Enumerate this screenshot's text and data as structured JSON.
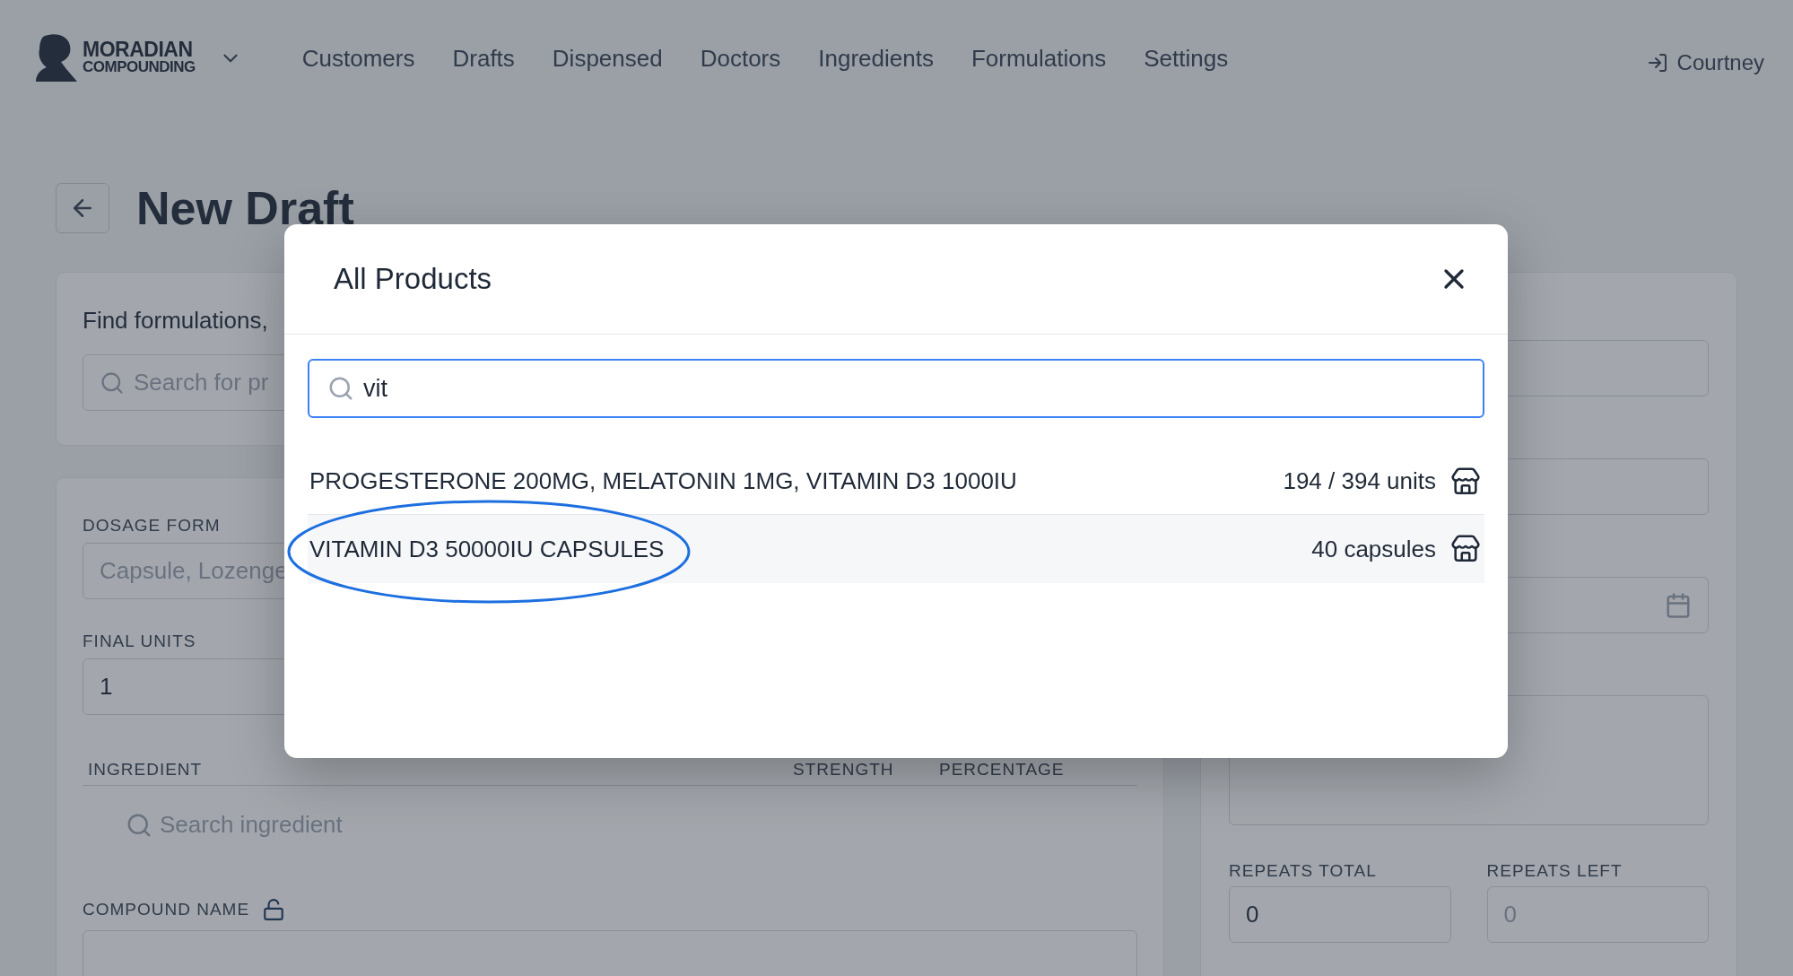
{
  "header": {
    "logo_line_1": "MORADIAN",
    "logo_line_2": "COMPOUNDING",
    "nav": [
      {
        "label": "Customers",
        "selected": false
      },
      {
        "label": "Drafts",
        "selected": false
      },
      {
        "label": "Dispensed",
        "selected": false
      },
      {
        "label": "Doctors",
        "selected": false
      },
      {
        "label": "Ingredients",
        "selected": false
      },
      {
        "label": "Formulations",
        "selected": false
      },
      {
        "label": "Settings",
        "selected": false
      }
    ],
    "user": "Courtney"
  },
  "page": {
    "title": "New Draft",
    "find_card": {
      "heading": "Find formulations,",
      "search_placeholder": "Search for pr"
    },
    "form": {
      "dosage_form": {
        "label": "DOSAGE FORM",
        "placeholder": "Capsule, Lozenge"
      },
      "final_units": {
        "label": "FINAL UNITS",
        "value": "1"
      },
      "ingredient_table": {
        "columns": [
          "INGREDIENT",
          "STRENGTH",
          "PERCENTAGE"
        ],
        "search_placeholder": "Search ingredient"
      },
      "compound_name": {
        "label": "COMPOUND NAME",
        "locked": false
      }
    },
    "side": {
      "fields": [
        {
          "kind": "text"
        },
        {
          "kind": "text"
        },
        {
          "kind": "date"
        },
        {
          "kind": "textarea"
        }
      ],
      "repeats": [
        {
          "label": "REPEATS TOTAL",
          "value": "0",
          "disabled": false
        },
        {
          "label": "REPEATS LEFT",
          "value": "0",
          "disabled": true
        }
      ]
    }
  },
  "modal": {
    "title": "All Products",
    "search_value": "vit",
    "results": [
      {
        "name": "PROGESTERONE 200MG, MELATONIN 1MG, VITAMIN D3 1000IU",
        "stock": "194 / 394 units",
        "selected": false,
        "circled": false
      },
      {
        "name": "VITAMIN D3 50000IU CAPSULES",
        "stock": "40 capsules",
        "selected": true,
        "circled": true
      }
    ]
  }
}
